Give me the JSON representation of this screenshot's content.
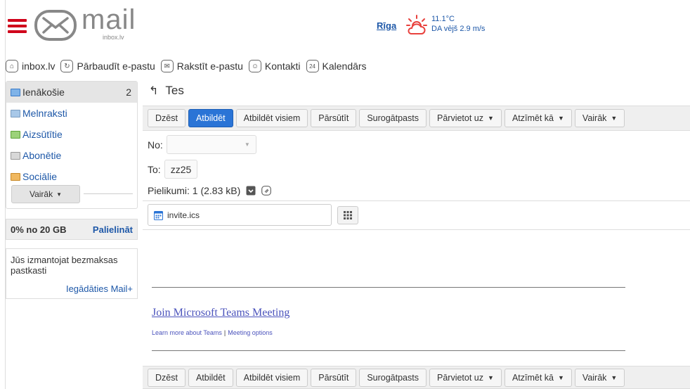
{
  "header": {
    "logo_text": "mail",
    "logo_sub": "inbox.lv",
    "weather": {
      "city": "Rīga",
      "temp": "11.1°C",
      "wind": "DA vējš 2.9 m/s"
    }
  },
  "nav": [
    {
      "label": "inbox.lv",
      "icon": "home-icon"
    },
    {
      "label": "Pārbaudīt e-pastu",
      "icon": "refresh-icon"
    },
    {
      "label": "Rakstīt e-pastu",
      "icon": "compose-icon"
    },
    {
      "label": "Kontakti",
      "icon": "contacts-icon"
    },
    {
      "label": "Kalendārs",
      "icon": "calendar-icon"
    }
  ],
  "sidebar": {
    "folders": [
      {
        "label": "Ienākošie",
        "count": "2"
      },
      {
        "label": "Melnraksti",
        "count": ""
      },
      {
        "label": "Aizsūtītie",
        "count": ""
      },
      {
        "label": "Abonētie",
        "count": ""
      },
      {
        "label": "Sociālie",
        "count": ""
      }
    ],
    "more_label": "Vairāk",
    "quota": "0% no 20 GB",
    "upgrade": "Palielināt",
    "promo_text": "Jūs izmantojat bezmaksas pastkasti",
    "promo_link": "Iegādāties Mail+"
  },
  "message": {
    "subject": "Tes",
    "from_label": "No:",
    "to_label": "To:",
    "to_value": "zz25",
    "attachments_label": "Pielikumi: 1 (2.83 kB)",
    "attachment_name": "invite.ics",
    "teams_link": "Join Microsoft Teams Meeting",
    "learn_more": "Learn more about Teams",
    "meeting_options": "Meeting options"
  },
  "toolbar": {
    "delete": "Dzēst",
    "reply": "Atbildēt",
    "reply_all": "Atbildēt visiem",
    "forward": "Pārsūtīt",
    "spam": "Surogātpasts",
    "move": "Pārvietot uz",
    "mark": "Atzīmēt kā",
    "more": "Vairāk"
  },
  "colors": {
    "accent": "#2a74d6",
    "brand_red": "#d0021b",
    "link": "#1e58a8",
    "teams": "#4b53bc"
  }
}
